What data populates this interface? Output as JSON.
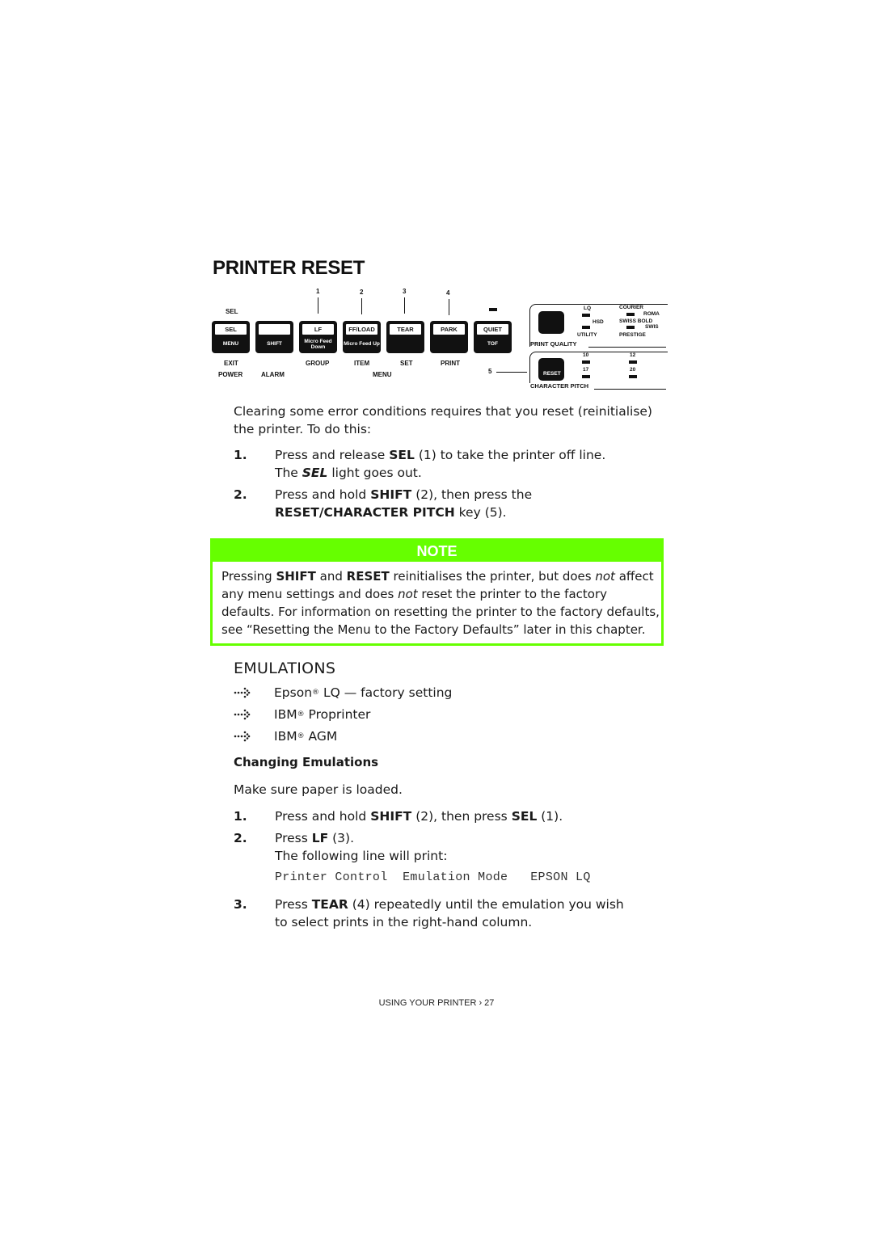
{
  "title": "PRINTER RESET",
  "panel": {
    "callout_numbers": [
      "1",
      "2",
      "3",
      "4",
      "5"
    ],
    "sel_indicator_label": "SEL",
    "keys": [
      {
        "top": "SEL",
        "bottom": "MENU",
        "below": "EXIT",
        "below2": "POWER"
      },
      {
        "top": "",
        "bottom": "SHIFT",
        "below": "",
        "below2": "ALARM"
      },
      {
        "top": "LF",
        "bottom": "Micro Feed Down",
        "below": "GROUP",
        "below2": ""
      },
      {
        "top": "FF/LOAD",
        "bottom": "Micro Feed Up",
        "below": "ITEM",
        "below2": "MENU"
      },
      {
        "top": "TEAR",
        "bottom": "",
        "below": "SET",
        "below2": ""
      },
      {
        "top": "PARK",
        "bottom": "",
        "below": "PRINT",
        "below2": ""
      },
      {
        "top": "QUIET",
        "bottom": "TOF",
        "below": "",
        "below2": ""
      }
    ],
    "print_quality": {
      "label": "PRINT QUALITY",
      "options": [
        "LQ",
        "HSD",
        "UTILITY"
      ],
      "fonts": [
        "COURIER",
        "ROMA",
        "SWISS BOLD",
        "SWIS",
        "PRESTIGE"
      ]
    },
    "character_pitch": {
      "label": "CHARACTER PITCH",
      "key_label": "RESET",
      "options": [
        "10",
        "12",
        "17",
        "20"
      ]
    }
  },
  "intro": {
    "text": "Clearing some error conditions requires that you reset (reinitialise) the printer. To do this:"
  },
  "reset_steps": [
    {
      "num": "1.",
      "pre": "Press and release ",
      "bold": "SEL",
      "post": " (1) to take the printer off line.",
      "line2_pre": "The ",
      "line2_bolditalic": "SEL",
      "line2_post": " light goes out."
    },
    {
      "num": "2.",
      "pre": "Press and hold ",
      "bold": "SHIFT",
      "mid": " (2), then press the ",
      "bold2": "RESET/CHARACTER PITCH",
      "post": " key (5)."
    }
  ],
  "note": {
    "heading": "NOTE",
    "t1": "Pressing ",
    "b1": "SHIFT",
    "t2": " and ",
    "b2": "RESET",
    "t3": " reinitialises the printer, but does ",
    "i1": "not",
    "t4": " affect any menu settings and does ",
    "i2": "not",
    "t5": " reset the printer to the factory defaults. For information on resetting the printer to the factory defaults, see “Resetting the Menu to the Factory Defaults” later in this chapter."
  },
  "emulations": {
    "heading": "EMULATIONS",
    "items": [
      {
        "brand": "Epson",
        "rest": " LQ — factory setting"
      },
      {
        "brand": "IBM",
        "rest": " Proprinter"
      },
      {
        "brand": "IBM",
        "rest": " AGM"
      }
    ],
    "reg_mark": "®"
  },
  "changing": {
    "heading": "Changing Emulations",
    "intro": "Make sure paper is loaded.",
    "steps": [
      {
        "num": "1.",
        "pre": "Press and hold ",
        "bold": "SHIFT",
        "mid": " (2), then press ",
        "bold2": "SEL",
        "post": " (1)."
      },
      {
        "num": "2.",
        "pre": "Press ",
        "bold": "LF",
        "post": " (3).",
        "line2": "The following line will print:"
      },
      {
        "num": "3.",
        "pre": "Press ",
        "bold": "TEAR",
        "post": " (4) repeatedly until the emulation you wish to select prints in the right-hand column."
      }
    ],
    "printout": "Printer Control  Emulation Mode   EPSON LQ"
  },
  "footer": "USING YOUR PRINTER › 27"
}
